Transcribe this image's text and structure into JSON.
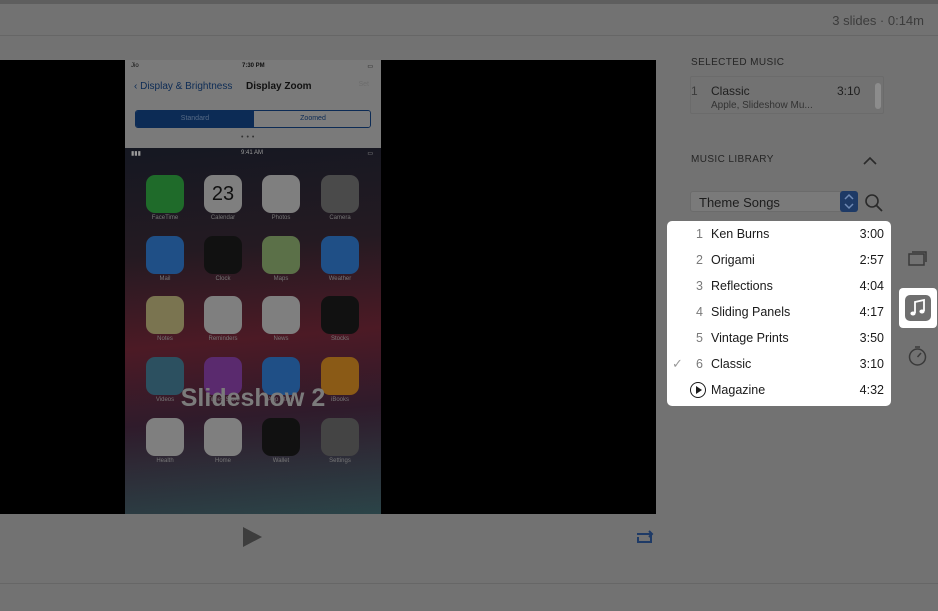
{
  "header": {
    "slide_info": "3 slides · 0:14m"
  },
  "preview": {
    "status_time": "7:30 PM",
    "status_carrier": "Jio",
    "nav_back": "Display & Brightness",
    "nav_title": "Display Zoom",
    "nav_done": "Set",
    "segment_standard": "Standard",
    "segment_zoomed": "Zoomed",
    "home_time": "9:41 AM",
    "apps": [
      {
        "label": "FaceTime",
        "color": "#1f6b2a"
      },
      {
        "label": "Calendar",
        "color": "#7f7f7f"
      },
      {
        "label": "Photos",
        "color": "#7f7f7f"
      },
      {
        "label": "Camera",
        "color": "#4a4a4a"
      },
      {
        "label": "Mail",
        "color": "#1f4f86"
      },
      {
        "label": "Clock",
        "color": "#111111"
      },
      {
        "label": "Maps",
        "color": "#5b7048"
      },
      {
        "label": "Weather",
        "color": "#1f4f86"
      },
      {
        "label": "Notes",
        "color": "#7a7450"
      },
      {
        "label": "Reminders",
        "color": "#7f7f7f"
      },
      {
        "label": "News",
        "color": "#7f7f7f"
      },
      {
        "label": "Stocks",
        "color": "#111111"
      },
      {
        "label": "Videos",
        "color": "#2c5060"
      },
      {
        "label": "iTunes Store",
        "color": "#5a2a6e"
      },
      {
        "label": "App Store",
        "color": "#1f4f86"
      },
      {
        "label": "iBooks",
        "color": "#8a5a16"
      },
      {
        "label": "Health",
        "color": "#7f7f7f"
      },
      {
        "label": "Home",
        "color": "#7f7f7f"
      },
      {
        "label": "Wallet",
        "color": "#111111"
      },
      {
        "label": "Settings",
        "color": "#444444"
      }
    ],
    "calendar_day": "23",
    "watermark": "Slideshow 2"
  },
  "panel": {
    "selected_music_title": "SELECTED MUSIC",
    "selected": {
      "number": "1",
      "title": "Classic",
      "subtitle": "Apple, Slideshow Mu...",
      "time": "3:10"
    },
    "library_title": "MUSIC LIBRARY",
    "dropdown_value": "Theme Songs"
  },
  "songs": [
    {
      "number": "1",
      "title": "Ken Burns",
      "time": "3:00"
    },
    {
      "number": "2",
      "title": "Origami",
      "time": "2:57"
    },
    {
      "number": "3",
      "title": "Reflections",
      "time": "4:04"
    },
    {
      "number": "4",
      "title": "Sliding Panels",
      "time": "4:17"
    },
    {
      "number": "5",
      "title": "Vintage Prints",
      "time": "3:50"
    },
    {
      "number": "6",
      "title": "Classic",
      "time": "3:10",
      "checked": true
    },
    {
      "number": "",
      "title": "Magazine",
      "time": "4:32",
      "playing": true
    }
  ],
  "colors": {
    "accent": "#1e3a66",
    "dim_overlay": "#727272",
    "highlight": "#ffffff"
  }
}
